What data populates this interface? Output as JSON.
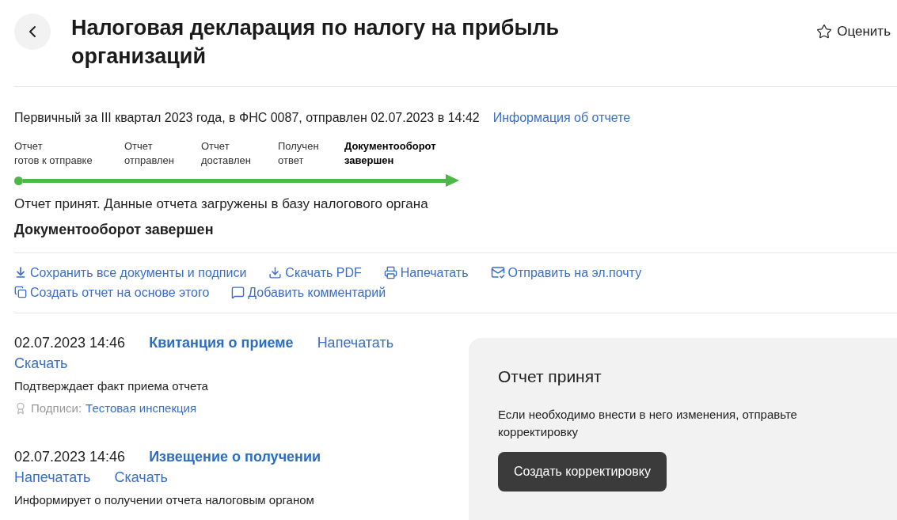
{
  "header": {
    "title": "Налоговая декларация по налогу на прибыль организаций",
    "rate_label": "Оценить"
  },
  "report": {
    "summary": "Первичный за III квартал 2023 года, в ФНС 0087, отправлен 02.07.2023 в 14:42",
    "info_link": "Информация об отчете",
    "steps": [
      {
        "line1": "Отчет",
        "line2": "готов к отправке",
        "selected": false
      },
      {
        "line1": "Отчет",
        "line2": "отправлен",
        "selected": false
      },
      {
        "line1": "Отчет",
        "line2": "доставлен",
        "selected": false
      },
      {
        "line1": "Получен",
        "line2": "ответ",
        "selected": false
      },
      {
        "line1": "Документооборот",
        "line2": "завершен",
        "selected": true
      }
    ],
    "progress": {
      "level": 1
    },
    "status_text": "Отчет принят. Данные отчета загружены в базу налогового органа",
    "status_title": "Документооборот завершен"
  },
  "actions": [
    [
      {
        "kind": "save",
        "label": "Сохранить все документы и подписи"
      },
      {
        "kind": "download",
        "label": "Скачать PDF"
      },
      {
        "kind": "print",
        "label": "Напечатать"
      },
      {
        "kind": "email",
        "label": "Отправить на эл.почту"
      }
    ],
    [
      {
        "kind": "copy",
        "label": "Создать отчет на основе этого"
      },
      {
        "kind": "comment",
        "label": "Добавить комментарий"
      }
    ]
  ],
  "documents": [
    {
      "datetime": "02.07.2023 14:46",
      "title": "Квитанция о приеме",
      "actions": [
        "Напечатать",
        "Скачать"
      ],
      "description": "Подтверждает факт приема отчета",
      "signatures_label": "Подписи:",
      "signer": "Тестовая инспекция"
    },
    {
      "datetime": "02.07.2023 14:46",
      "title": "Извещение о получении",
      "actions": [
        "Напечатать",
        "Скачать"
      ],
      "description": "Информирует о получении отчета налоговым органом"
    }
  ],
  "side_card": {
    "title": "Отчет принят",
    "text": "Если необходимо внести в него изменения, отправьте корректировку",
    "button": "Создать корректировку"
  }
}
